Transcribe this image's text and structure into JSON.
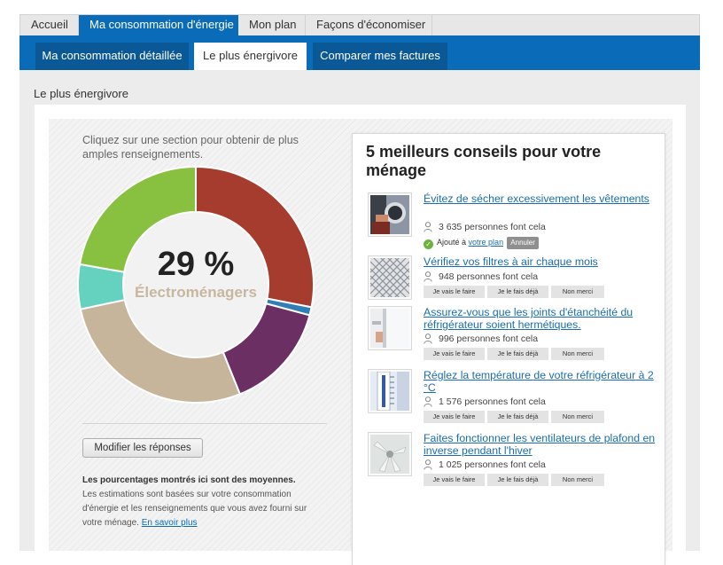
{
  "nav": {
    "top_tabs": [
      "Accueil",
      "Ma consommation d'énergie",
      "Mon plan",
      "Façons d'économiser"
    ],
    "sub_tabs": [
      "Ma consommation détaillée",
      "Le plus énergivore",
      "Comparer mes factures"
    ]
  },
  "page": {
    "section_title": "Le plus énergivore",
    "instructions": "Cliquez sur une section pour obtenir de plus amples renseignements.",
    "selected_percent": "29 %",
    "selected_category": "Électroménagers",
    "modify_button": "Modifier les réponses",
    "note_bold": "Les pourcentages montrés ici sont des moyennes.",
    "note_text": "Les estimations sont basées sur votre consommation d'énergie et les renseignements que vous avez fourni sur votre ménage.",
    "note_link": "En savoir plus"
  },
  "donut": {
    "segments": [
      {
        "color": "#a63c2d"
      },
      {
        "color": "#2f7fb6"
      },
      {
        "color": "#6b2f64"
      },
      {
        "color": "#c6b59b"
      },
      {
        "color": "#64d2bf"
      },
      {
        "color": "#88c040"
      }
    ]
  },
  "tips": {
    "title": "5 meilleurs conseils pour votre ménage",
    "action_labels": [
      "Je vais le faire",
      "Je le fais déjà",
      "Non merci"
    ],
    "added_prefix": "Ajouté à",
    "added_link": "votre plan",
    "cancel_label": "Annuler",
    "items": [
      {
        "title": "Évitez de sécher excessivement les vêtements",
        "people": "3 635 personnes font cela",
        "icon": "dryer-photo-icon"
      },
      {
        "title": "Vérifiez vos filtres à air chaque mois",
        "people": "948 personnes font cela",
        "icon": "air-filter-photo-icon"
      },
      {
        "title": "Assurez-vous que les joints d'étanchéité du réfrigérateur soient hermétiques.",
        "people": "996 personnes font cela",
        "icon": "fridge-seal-photo-icon"
      },
      {
        "title": "Réglez la température de votre réfrigérateur à 2 °C",
        "people": "1 576 personnes font cela",
        "icon": "thermometer-photo-icon"
      },
      {
        "title": "Faites fonctionner les ventilateurs de plafond en inverse pendant l'hiver",
        "people": "1 025 personnes font cela",
        "icon": "ceiling-fan-photo-icon"
      }
    ]
  }
}
